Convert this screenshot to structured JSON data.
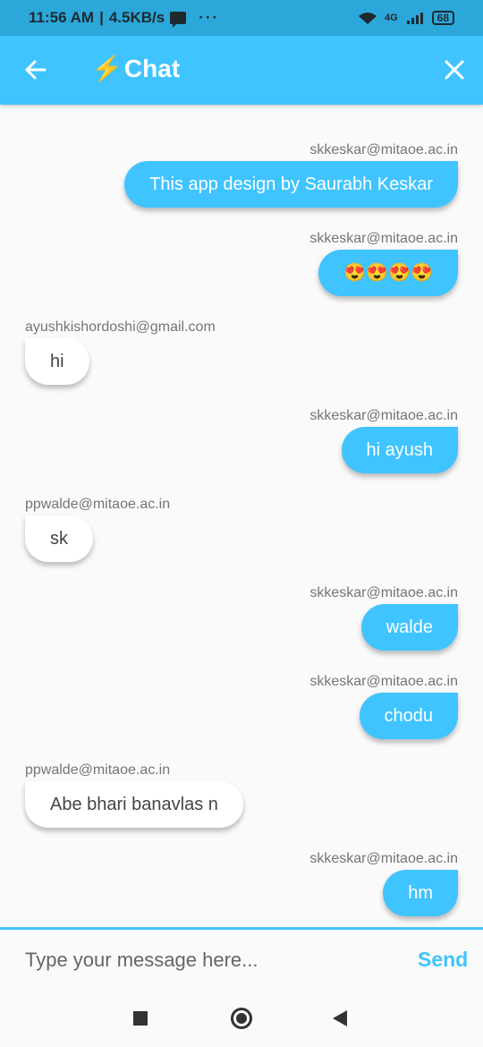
{
  "status_bar": {
    "time": "11:56 AM",
    "speed": "4.5KB/s",
    "more": "···",
    "network": "4G",
    "battery": "68"
  },
  "app_bar": {
    "bolt": "⚡",
    "title": "Chat",
    "back_icon": "arrow-left-icon",
    "close_icon": "close-icon",
    "color": "#40c4ff"
  },
  "messages": [
    {
      "sender": "skkeskar@mitaoe.ac.in",
      "text": "This app design by Saurabh Keskar",
      "side": "right"
    },
    {
      "sender": "skkeskar@mitaoe.ac.in",
      "text": "😍😍😍😍",
      "side": "right"
    },
    {
      "sender": "ayushkishordoshi@gmail.com",
      "text": "hi",
      "side": "left"
    },
    {
      "sender": "skkeskar@mitaoe.ac.in",
      "text": "hi ayush",
      "side": "right"
    },
    {
      "sender": "ppwalde@mitaoe.ac.in",
      "text": "sk",
      "side": "left"
    },
    {
      "sender": "skkeskar@mitaoe.ac.in",
      "text": "walde",
      "side": "right"
    },
    {
      "sender": "skkeskar@mitaoe.ac.in",
      "text": "chodu",
      "side": "right"
    },
    {
      "sender": "ppwalde@mitaoe.ac.in",
      "text": "Abe bhari banavlas n",
      "side": "left"
    },
    {
      "sender": "skkeskar@mitaoe.ac.in",
      "text": "hm",
      "side": "right"
    }
  ],
  "composer": {
    "placeholder": "Type your message here...",
    "send_label": "Send"
  }
}
